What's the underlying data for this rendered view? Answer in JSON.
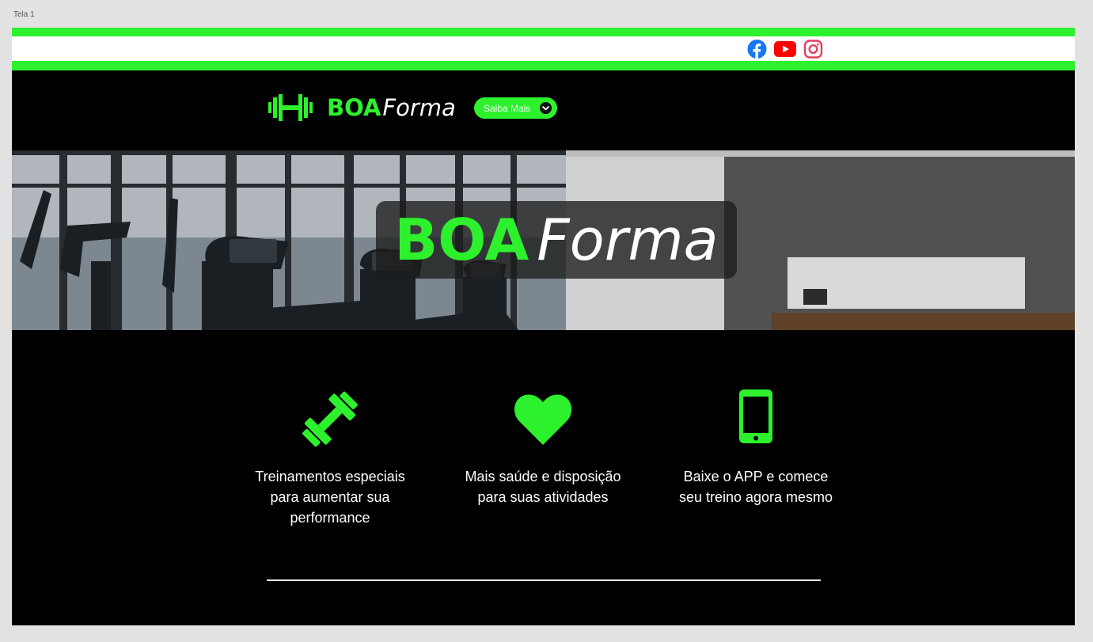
{
  "canvas": {
    "label": "Tela 1"
  },
  "colors": {
    "accent": "#2df12d",
    "facebook": "#1877f2",
    "youtube": "#ff0000",
    "instagram": "#e4405f",
    "background": "#000000"
  },
  "social": {
    "icons": [
      {
        "name": "facebook-icon"
      },
      {
        "name": "youtube-icon"
      },
      {
        "name": "instagram-icon"
      }
    ]
  },
  "header": {
    "logo_icon": "dumbbell-icon",
    "brand": {
      "bold": "BOA",
      "italic": "Forma"
    },
    "saiba_mais": {
      "label": "Saiba Mais",
      "icon": "chevron-down-circle-icon"
    }
  },
  "hero": {
    "title": {
      "bold": "BOA",
      "italic": "Forma"
    },
    "image": "gym-treadmills-photo"
  },
  "features": [
    {
      "icon": "dumbbell-icon",
      "text": "Treinamentos especiais para aumentar sua performance"
    },
    {
      "icon": "heart-icon",
      "text": "Mais saúde e disposição para suas atividades"
    },
    {
      "icon": "smartphone-icon",
      "text": "Baixe o APP e comece seu treino agora mesmo"
    }
  ]
}
